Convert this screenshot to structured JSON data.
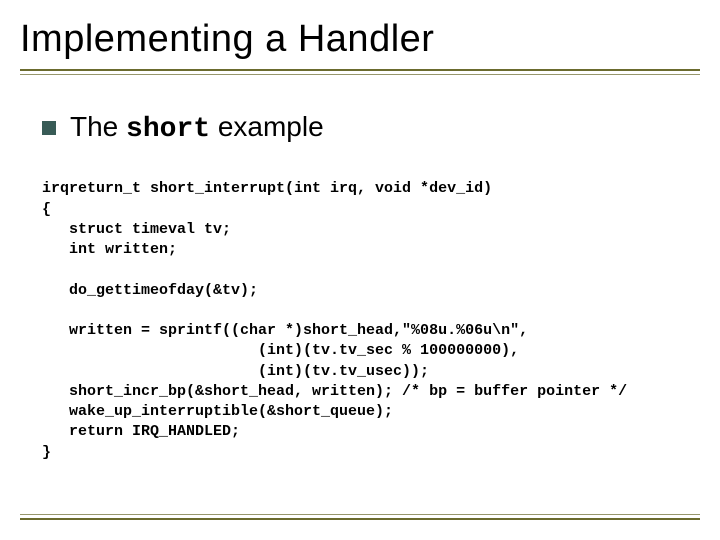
{
  "title": "Implementing a Handler",
  "bullet": {
    "prefix": "The ",
    "mono": "short",
    "suffix": " example"
  },
  "code_lines": [
    "irqreturn_t short_interrupt(int irq, void *dev_id)",
    "{",
    "   struct timeval tv;",
    "   int written;",
    "",
    "   do_gettimeofday(&tv);",
    "",
    "   written = sprintf((char *)short_head,\"%08u.%06u\\n\",",
    "                        (int)(tv.tv_sec % 100000000),",
    "                        (int)(tv.tv_usec));",
    "   short_incr_bp(&short_head, written); /* bp = buffer pointer */",
    "   wake_up_interruptible(&short_queue);",
    "   return IRQ_HANDLED;",
    "}"
  ]
}
